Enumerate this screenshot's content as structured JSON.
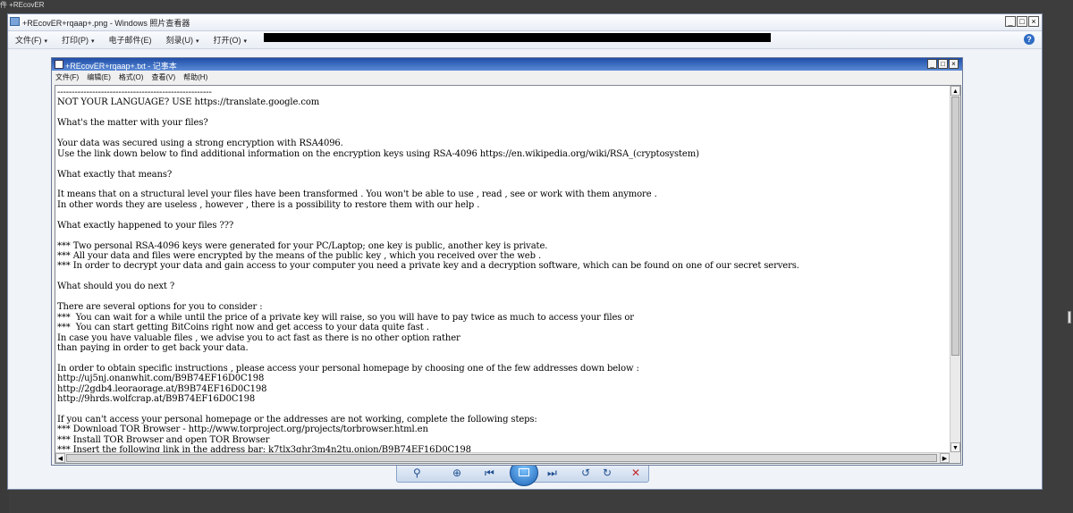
{
  "desktop": {
    "label": "件 +REcovER"
  },
  "viewer": {
    "title": "+REcovER+rqaap+.png - Windows 照片查看器",
    "menu": [
      {
        "label": "文件(F)",
        "dropdown": true
      },
      {
        "label": "打印(P)",
        "dropdown": true
      },
      {
        "label": "电子邮件(E)",
        "dropdown": false
      },
      {
        "label": "刻录(U)",
        "dropdown": true
      },
      {
        "label": "打开(O)",
        "dropdown": true
      }
    ],
    "help_glyph": "?",
    "toolbar": {
      "zoom": "⚲",
      "fit": "⊕",
      "prev": "⏮",
      "next": "⏭",
      "rotate_ccw": "↺",
      "rotate_cw": "↻",
      "delete": "✕"
    }
  },
  "notepad": {
    "title": "+REcovER+rqaap+.txt - 记事本",
    "menu": [
      "文件(F)",
      "编辑(E)",
      "格式(O)",
      "查看(V)",
      "帮助(H)"
    ],
    "lines": [
      "-----------------------------------------------------",
      "NOT YOUR LANGUAGE? USE https://translate.google.com",
      "",
      "What's the matter with your files?",
      "",
      "Your data was secured using a strong encryption with RSA4096.",
      "Use the link down below to find additional information on the encryption keys using RSA-4096 https://en.wikipedia.org/wiki/RSA_(cryptosystem)",
      "",
      "What exactly that means?",
      "",
      "It means that on a structural level your files have been transformed . You won't be able to use , read , see or work with them anymore .",
      "In other words they are useless , however , there is a possibility to restore them with our help .",
      "",
      "What exactly happened to your files ???",
      "",
      "*** Two personal RSA-4096 keys were generated for your PC/Laptop; one key is public, another key is private.",
      "*** All your data and files were encrypted by the means of the public key , which you received over the web .",
      "*** In order to decrypt your data and gain access to your computer you need a private key and a decryption software, which can be found on one of our secret servers.",
      "",
      "What should you do next ?",
      "",
      "There are several options for you to consider :",
      "***  You can wait for a while until the price of a private key will raise, so you will have to pay twice as much to access your files or",
      "***  You can start getting BitCoins right now and get access to your data quite fast .",
      "In case you have valuable files , we advise you to act fast as there is no other option rather",
      "than paying in order to get back your data.",
      "",
      "In order to obtain specific instructions , please access your personal homepage by choosing one of the few addresses down below :",
      "http://uj5nj.onanwhit.com/B9B74EF16D0C198",
      "http://2gdb4.leoraorage.at/B9B74EF16D0C198",
      "http://9hrds.wolfcrap.at/B9B74EF16D0C198",
      "",
      "If you can't access your personal homepage or the addresses are not working, complete the following steps:",
      "*** Download TOR Browser - http://www.torproject.org/projects/torbrowser.html.en",
      "*** Install TOR Browser and open TOR Browser",
      "*** Insert the following link in the address bar: k7tlx3ghr3m4n2tu.onion/B9B74EF16D0C198"
    ]
  }
}
